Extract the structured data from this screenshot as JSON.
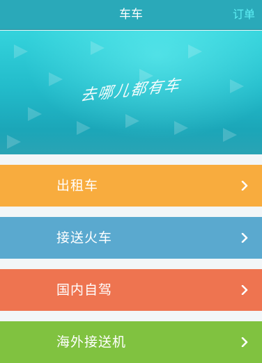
{
  "header": {
    "title": "车车",
    "action_label": "订单"
  },
  "banner": {
    "tagline": "去哪儿都有车"
  },
  "menu": {
    "items": [
      {
        "label": "出租车",
        "color": "#f8ac3e",
        "icon": "chevron-right-icon"
      },
      {
        "label": "接送火车",
        "color": "#5aa9cf",
        "icon": "chevron-right-icon"
      },
      {
        "label": "国内自驾",
        "color": "#ee7450",
        "icon": "chevron-right-icon"
      },
      {
        "label": "海外接送机",
        "color": "#80c240",
        "icon": "chevron-right-icon"
      }
    ]
  }
}
